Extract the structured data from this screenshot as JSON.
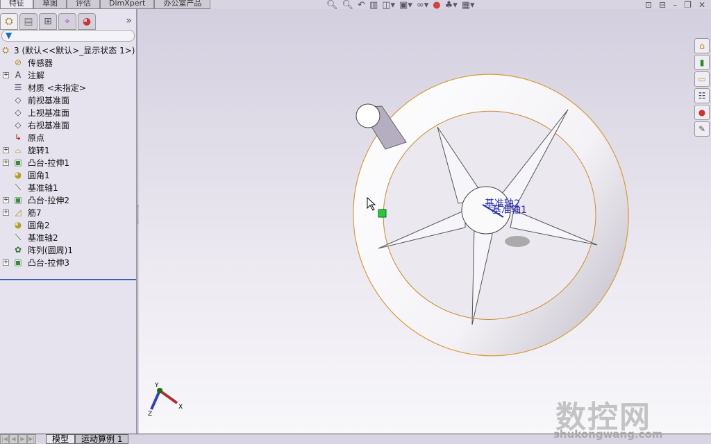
{
  "cmd_tabs": [
    "特征",
    "草图",
    "评估",
    "DimXpert",
    "办公室产品"
  ],
  "panel_tabs": [
    {
      "icon": "feature-manager-icon"
    },
    {
      "icon": "property-manager-icon"
    },
    {
      "icon": "configuration-manager-icon"
    },
    {
      "icon": "dimxpert-manager-icon"
    },
    {
      "icon": "display-manager-icon"
    }
  ],
  "expand_label": "»",
  "filter_icon": "▼",
  "tree": [
    {
      "label": "3  (默认<<默认>_显示状态 1>)",
      "icon": "part-icon",
      "expand": false,
      "root": true
    },
    {
      "label": "传感器",
      "icon": "sensor-folder-icon",
      "expand": false
    },
    {
      "label": "注解",
      "icon": "annotation-icon",
      "expand": true
    },
    {
      "label": "材质 <未指定>",
      "icon": "material-icon",
      "expand": false
    },
    {
      "label": "前视基准面",
      "icon": "plane-icon",
      "expand": false
    },
    {
      "label": "上视基准面",
      "icon": "plane-icon",
      "expand": false
    },
    {
      "label": "右视基准面",
      "icon": "plane-icon",
      "expand": false
    },
    {
      "label": "原点",
      "icon": "origin-icon",
      "expand": false
    },
    {
      "label": "旋转1",
      "icon": "revolve-icon",
      "expand": true
    },
    {
      "label": "凸台-拉伸1",
      "icon": "extrude-icon",
      "expand": true
    },
    {
      "label": "圆角1",
      "icon": "fillet-icon",
      "expand": false
    },
    {
      "label": "基准轴1",
      "icon": "axis-icon",
      "expand": false
    },
    {
      "label": "凸台-拉伸2",
      "icon": "extrude-icon",
      "expand": true
    },
    {
      "label": "筋7",
      "icon": "rib-icon",
      "expand": true
    },
    {
      "label": "圆角2",
      "icon": "fillet-icon",
      "expand": false
    },
    {
      "label": "基准轴2",
      "icon": "axis-icon",
      "expand": false
    },
    {
      "label": "阵列(圆周)1",
      "icon": "circular-pattern-icon",
      "expand": false
    },
    {
      "label": "凸台-拉伸3",
      "icon": "extrude-icon",
      "expand": true
    }
  ],
  "viewport": {
    "axis_label_1": "基准轴1",
    "axis_label_2": "基准轴2",
    "triad": {
      "x": "X",
      "y": "Y",
      "z": "Z"
    }
  },
  "bottom_tabs": [
    "模型",
    "运动算例 1"
  ],
  "watermark": {
    "text": "数控网",
    "url": "shukongwang.com"
  }
}
